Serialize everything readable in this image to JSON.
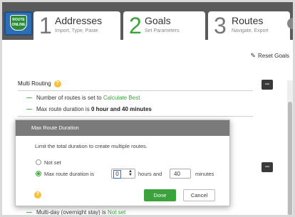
{
  "logo_text": "ROUTE ONLINE",
  "steps": [
    {
      "num": "1",
      "title": "Addresses",
      "sub": "Import, Type, Paste"
    },
    {
      "num": "2",
      "title": "Goals",
      "sub": "Set Parameters"
    },
    {
      "num": "3",
      "title": "Routes",
      "sub": "Navigate, Export"
    }
  ],
  "reset_label": "Reset Goals",
  "multi_routing": {
    "title": "Multi Routing",
    "help": "?",
    "routes_prefix": "Number of routes is set to",
    "routes_value": "Calculate Best",
    "duration_prefix": "Max route duration is",
    "duration_value": "0 hour and 40 minutes"
  },
  "partial_letter": "O",
  "multiday": {
    "prefix": "Multi-day (overnight stay) is",
    "value": "Not set"
  },
  "modal": {
    "title": "Max Route Duration",
    "description": "Limit the total duration to create multiple routes.",
    "option_not_set": "Not set",
    "option_max": "Max route duration is",
    "hours_value": "0",
    "hours_label": "hours and",
    "minutes_value": "40",
    "minutes_label": "minutes",
    "help": "?",
    "done_label": "Done",
    "cancel_label": "Cancel"
  },
  "colors": {
    "accent": "#3aa43a",
    "header_bg": "#5a5a5a",
    "modal_header": "#7a7a7a"
  }
}
